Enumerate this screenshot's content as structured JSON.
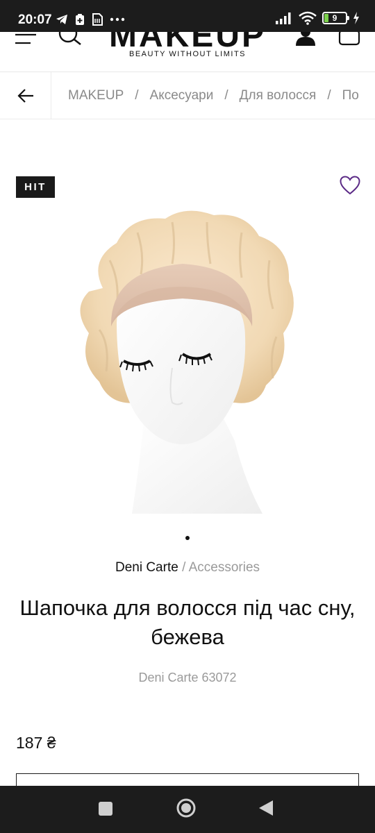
{
  "status_bar": {
    "time": "20:07",
    "battery_level": "9"
  },
  "header": {
    "logo": "MAKEUP",
    "tagline": "BEAUTY WITHOUT LIMITS"
  },
  "breadcrumbs": {
    "items": [
      "MAKEUP",
      "Аксесуари",
      "Для волосся",
      "По"
    ],
    "separator": "/"
  },
  "product": {
    "badge": "HIT",
    "brand": "Deni Carte",
    "brand_separator": "/",
    "category": "Accessories",
    "title": "Шапочка для волосся під час сну, бежева",
    "sku": "Deni Carte 63072",
    "price": "187 ₴",
    "image_description": "beige satin sleep bonnet on mannequin head"
  },
  "colors": {
    "status_bar_bg": "#1c1c1c",
    "badge_bg": "#1a1a1a",
    "wishlist_heart": "#5b2a86",
    "muted_text": "#9a9a9a"
  }
}
